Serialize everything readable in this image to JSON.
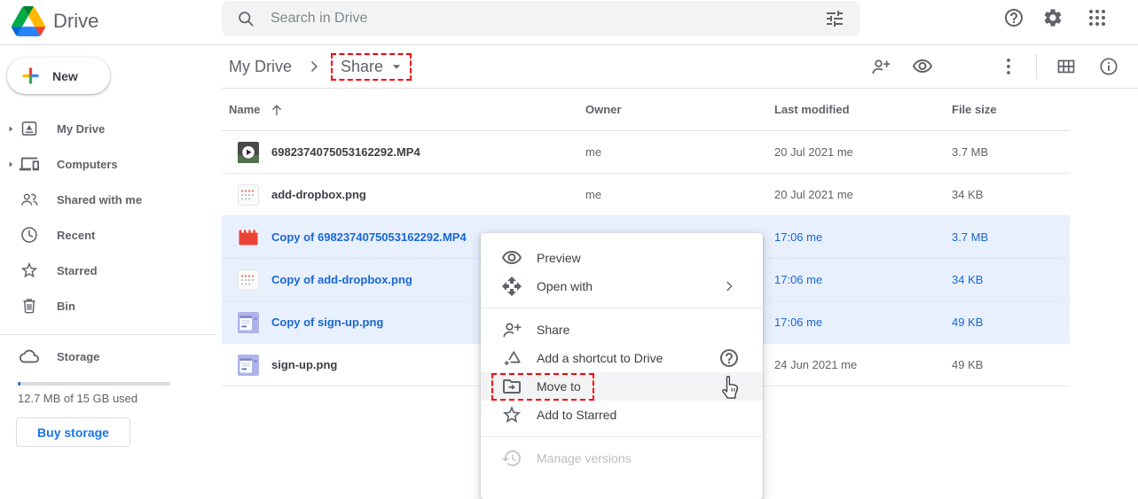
{
  "topbar": {
    "app_name": "Drive",
    "search": {
      "placeholder": "Search in Drive"
    }
  },
  "sidebar": {
    "new_button_label": "New",
    "items": [
      {
        "label": "My Drive",
        "icon": "my-drive-icon",
        "expandable": true
      },
      {
        "label": "Computers",
        "icon": "computers-icon",
        "expandable": true
      },
      {
        "label": "Shared with me",
        "icon": "shared-icon",
        "expandable": false
      },
      {
        "label": "Recent",
        "icon": "recent-icon",
        "expandable": false
      },
      {
        "label": "Starred",
        "icon": "star-icon",
        "expandable": false
      },
      {
        "label": "Bin",
        "icon": "trash-icon",
        "expandable": false
      }
    ],
    "storage": {
      "label": "Storage",
      "usage_text": "12.7 MB of 15 GB used",
      "buy_button_label": "Buy storage"
    }
  },
  "breadcrumb": {
    "root": "My Drive",
    "current": "Share"
  },
  "table": {
    "headers": {
      "name": "Name",
      "owner": "Owner",
      "modified": "Last modified",
      "size": "File size"
    },
    "rows": [
      {
        "icon": "video-thumbnail",
        "name": "6982374075053162292.MP4",
        "owner": "me",
        "modified": "20 Jul 2021  me",
        "size": "3.7 MB",
        "selected": false
      },
      {
        "icon": "image-thumbnail-dropbox",
        "name": "add-dropbox.png",
        "owner": "me",
        "modified": "20 Jul 2021  me",
        "size": "34 KB",
        "selected": false
      },
      {
        "icon": "video-file-icon",
        "name": "Copy of 6982374075053162292.MP4",
        "owner": "",
        "modified": "17:06 me",
        "size": "3.7 MB",
        "selected": true
      },
      {
        "icon": "image-thumbnail-dropbox",
        "name": "Copy of add-dropbox.png",
        "owner": "",
        "modified": "17:06 me",
        "size": "34 KB",
        "selected": true
      },
      {
        "icon": "image-thumbnail-signup",
        "name": "Copy of sign-up.png",
        "owner": "",
        "modified": "17:06 me",
        "size": "49 KB",
        "selected": true
      },
      {
        "icon": "image-thumbnail-signup",
        "name": "sign-up.png",
        "owner": "",
        "modified": "24 Jun 2021  me",
        "size": "49 KB",
        "selected": false
      }
    ]
  },
  "context_menu": {
    "items": [
      {
        "type": "item",
        "label": "Preview",
        "icon": "eye-icon"
      },
      {
        "type": "item",
        "label": "Open with",
        "icon": "open-with-icon",
        "submenu": true
      },
      {
        "type": "divider"
      },
      {
        "type": "item",
        "label": "Share",
        "icon": "person-add-icon"
      },
      {
        "type": "item",
        "label": "Add a shortcut to Drive",
        "icon": "add-shortcut-icon",
        "help": true
      },
      {
        "type": "item",
        "label": "Move to",
        "icon": "move-to-icon",
        "highlighted": true,
        "annotated": true
      },
      {
        "type": "item",
        "label": "Add to Starred",
        "icon": "star-icon"
      },
      {
        "type": "divider"
      },
      {
        "type": "item",
        "label": "Manage versions",
        "icon": "history-icon",
        "disabled": true
      }
    ]
  },
  "colors": {
    "accent_blue": "#1a73e8",
    "selected_text": "#1967d2",
    "selected_row_bg": "#e8f0fe",
    "annotation_red": "#fb0007"
  }
}
